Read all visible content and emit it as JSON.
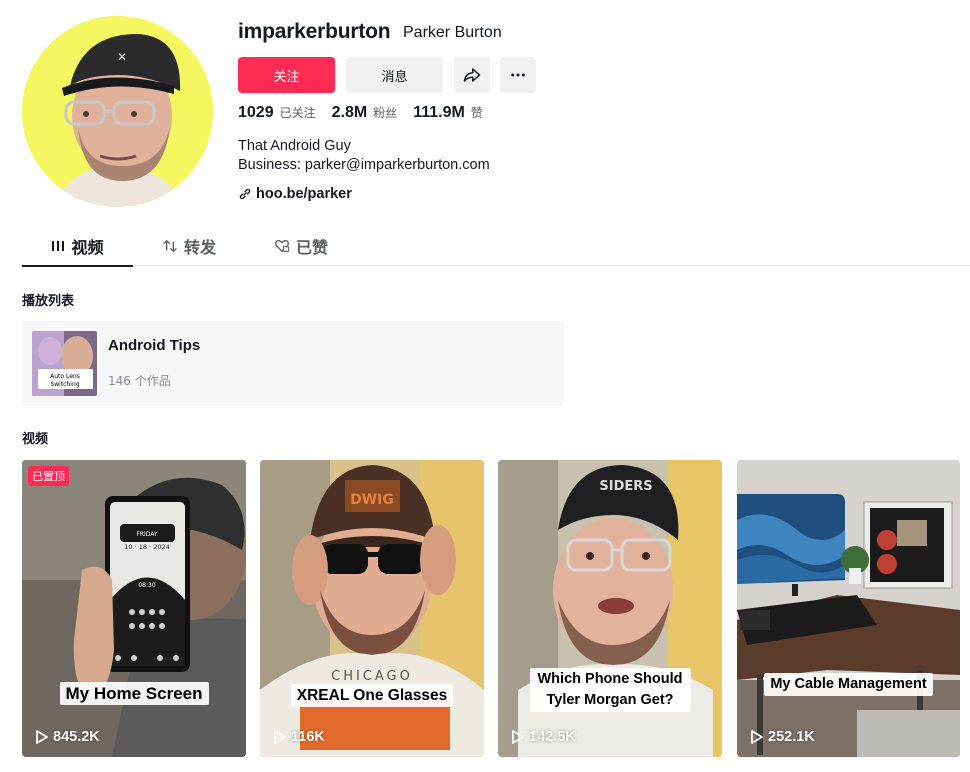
{
  "profile": {
    "username": "imparkerburton",
    "nickname": "Parker Burton",
    "follow_label": "关注",
    "message_label": "消息",
    "stats": [
      {
        "value": "1029",
        "label": "已关注"
      },
      {
        "value": "2.8M",
        "label": "粉丝"
      },
      {
        "value": "111.9M",
        "label": "赞"
      }
    ],
    "bio_line1": "That Android Guy",
    "bio_line2": "Business: parker@imparkerburton.com",
    "link": "hoo.be/parker"
  },
  "tabs": [
    {
      "label": "视频",
      "icon": "grid-icon",
      "active": true
    },
    {
      "label": "转发",
      "icon": "repost-icon",
      "active": false
    },
    {
      "label": "已赞",
      "icon": "heart-icon",
      "active": false
    }
  ],
  "playlist_section": {
    "title": "播放列表",
    "name": "Android Tips",
    "count": "146 个作品",
    "thumb_text_line1": "Auto Lens",
    "thumb_text_line2": "Switching"
  },
  "videos_section": {
    "title": "视频",
    "items": [
      {
        "caption": "My Home Screen",
        "views": "845.2K",
        "pinned": "已置顶",
        "phone_day": "FRIDAY",
        "phone_date": "10 · 18 · 2024",
        "phone_time": "08:30"
      },
      {
        "caption": "XREAL One Glasses",
        "views": "116K",
        "cap_text": "DWIG",
        "shirt_text": "CHICAGO"
      },
      {
        "caption_line1": "Which Phone Should",
        "caption_line2": "Tyler Morgan Get?",
        "views": "142.5K",
        "cap_text": "SIDERS"
      },
      {
        "caption": "My Cable Management",
        "views": "252.1K"
      }
    ]
  },
  "colors": {
    "accent": "#fe2c55",
    "text_primary": "#161823",
    "text_secondary": "#5c5e66",
    "avatar_bg": "#f5f760"
  }
}
